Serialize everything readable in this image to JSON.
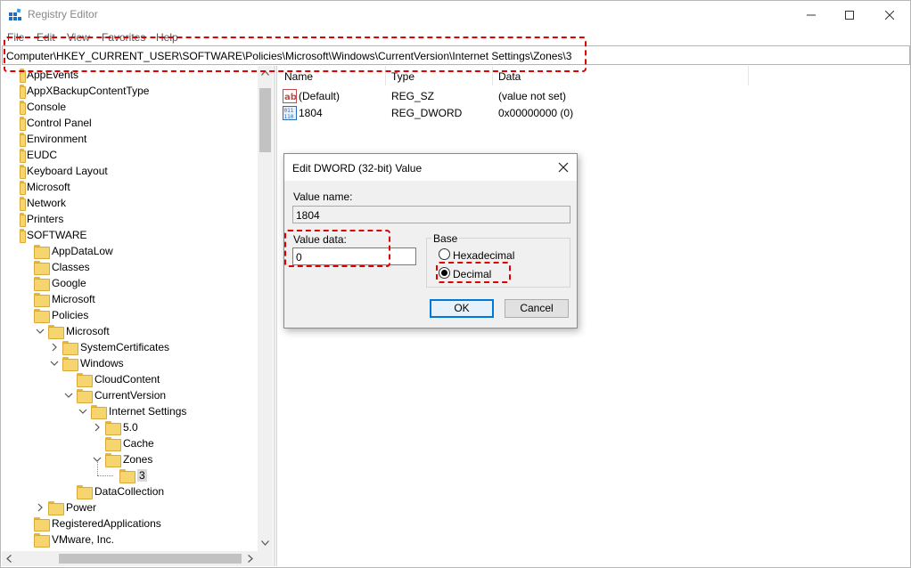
{
  "window": {
    "title": "Registry Editor"
  },
  "menu": [
    "File",
    "Edit",
    "View",
    "Favorites",
    "Help"
  ],
  "address": {
    "path": "Computer\\HKEY_CURRENT_USER\\SOFTWARE\\Policies\\Microsoft\\Windows\\CurrentVersion\\Internet Settings\\Zones\\3"
  },
  "tree": [
    {
      "label": "AppEvents",
      "level": 0,
      "expander": "none",
      "cut": true
    },
    {
      "label": "AppXBackupContentType",
      "level": 0,
      "expander": "none",
      "cut": true
    },
    {
      "label": "Console",
      "level": 0,
      "expander": "none",
      "cut": true
    },
    {
      "label": "Control Panel",
      "level": 0,
      "expander": "none",
      "cut": true
    },
    {
      "label": "Environment",
      "level": 0,
      "expander": "none",
      "cut": true
    },
    {
      "label": "EUDC",
      "level": 0,
      "expander": "none",
      "cut": true
    },
    {
      "label": "Keyboard Layout",
      "level": 0,
      "expander": "none",
      "cut": true
    },
    {
      "label": "Microsoft",
      "level": 0,
      "expander": "none",
      "cut": true
    },
    {
      "label": "Network",
      "level": 0,
      "expander": "none",
      "cut": true
    },
    {
      "label": "Printers",
      "level": 0,
      "expander": "none",
      "cut": true
    },
    {
      "label": "SOFTWARE",
      "level": 0,
      "expander": "none",
      "cut": true
    },
    {
      "label": "AppDataLow",
      "level": 1,
      "expander": "none"
    },
    {
      "label": "Classes",
      "level": 1,
      "expander": "none"
    },
    {
      "label": "Google",
      "level": 1,
      "expander": "none"
    },
    {
      "label": "Microsoft",
      "level": 1,
      "expander": "none"
    },
    {
      "label": "Policies",
      "level": 1,
      "expander": "none"
    },
    {
      "label": "Microsoft",
      "level": 2,
      "expander": "open"
    },
    {
      "label": "SystemCertificates",
      "level": 3,
      "expander": "closed"
    },
    {
      "label": "Windows",
      "level": 3,
      "expander": "open"
    },
    {
      "label": "CloudContent",
      "level": 4,
      "expander": "none"
    },
    {
      "label": "CurrentVersion",
      "level": 4,
      "expander": "open"
    },
    {
      "label": "Internet Settings",
      "level": 5,
      "expander": "open"
    },
    {
      "label": "5.0",
      "level": 6,
      "expander": "closed"
    },
    {
      "label": "Cache",
      "level": 6,
      "expander": "none"
    },
    {
      "label": "Zones",
      "level": 6,
      "expander": "open"
    },
    {
      "label": "3",
      "level": 7,
      "expander": "none",
      "selected": true
    },
    {
      "label": "DataCollection",
      "level": 4,
      "expander": "none"
    },
    {
      "label": "Power",
      "level": 2,
      "expander": "closed"
    },
    {
      "label": "RegisteredApplications",
      "level": 1,
      "expander": "none"
    },
    {
      "label": "VMware, Inc.",
      "level": 1,
      "expander": "none"
    }
  ],
  "list": {
    "columns": [
      "Name",
      "Type",
      "Data"
    ],
    "rows": [
      {
        "icon": "string-value-icon",
        "name": "(Default)",
        "type": "REG_SZ",
        "data": "(value not set)"
      },
      {
        "icon": "dword-value-icon",
        "name": "1804",
        "type": "REG_DWORD",
        "data": "0x00000000 (0)"
      }
    ]
  },
  "dialog": {
    "title": "Edit DWORD (32-bit) Value",
    "value_name_label": "Value name:",
    "value_name": "1804",
    "value_data_label": "Value data:",
    "value_data": "0",
    "base_label": "Base",
    "hex_label": "Hexadecimal",
    "dec_label": "Decimal",
    "selected_base": "Decimal",
    "ok_label": "OK",
    "cancel_label": "Cancel"
  },
  "colors": {
    "highlight_dash": "#e00000",
    "folder": "#f6d56f",
    "default_button_border": "#0078d7"
  }
}
